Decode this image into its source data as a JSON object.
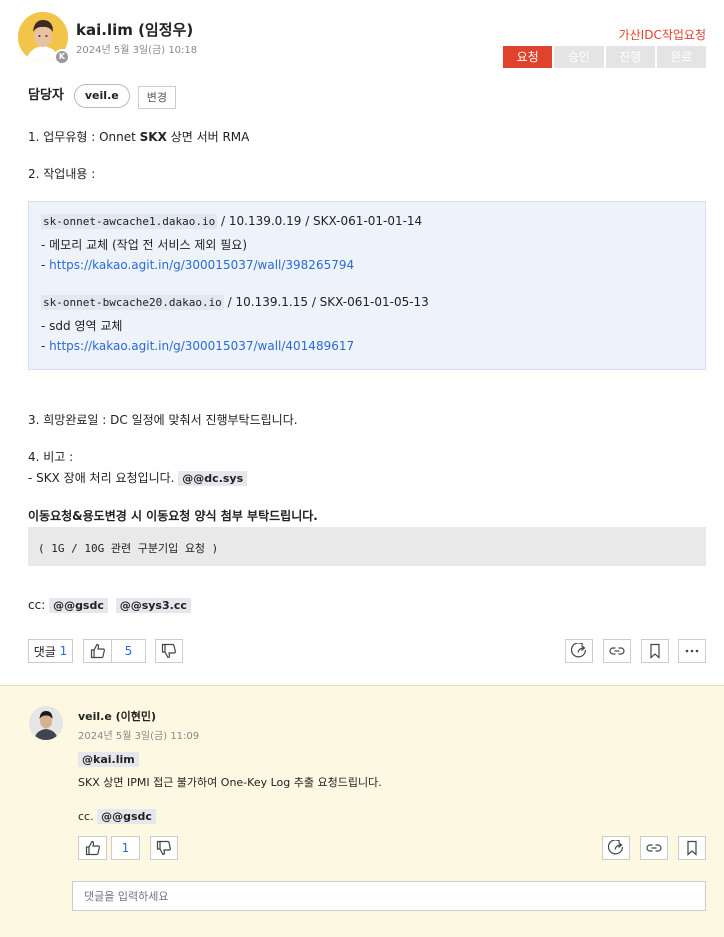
{
  "post": {
    "author_name": "kai.lim (임정우)",
    "avatar_badge": "K",
    "date": "2024년 5월 3일(금) 10:18",
    "group": "가산IDC작업요청",
    "status_steps": [
      "요청",
      "승인",
      "진행",
      "완료"
    ],
    "active_step": "요청",
    "assignee_label": "담당자",
    "assignee": "veil.e",
    "change_label": "변경",
    "line1_prefix": "1. 업무유형 : Onnet ",
    "line1_bold": "SKX",
    "line1_suffix": " 상면 서버 RMA",
    "line2": "2. 작업내용 :",
    "hosts": [
      {
        "code": "sk-onnet-awcache1.dakao.io",
        "info": " / 10.139.0.19 / SKX-061-01-01-14",
        "task": "- 메모리 교체 (작업 전 서비스 제외 필요)",
        "dash": "- ",
        "url": "https://kakao.agit.in/g/300015037/wall/398265794"
      },
      {
        "code": "sk-onnet-bwcache20.dakao.io",
        "info": " / 10.139.1.15 / SKX-061-01-05-13",
        "task": "- sdd 영역 교체",
        "dash": "- ",
        "url": "https://kakao.agit.in/g/300015037/wall/401489617"
      }
    ],
    "line3": "3. 희망완료일 : DC 일정에 맞춰서 진행부탁드립니다.",
    "line4": "4. 비고 :",
    "note": "- SKX 장애 처리 요청입니다. ",
    "note_mention": "@@dc.sys",
    "bold_notice": "이동요청&용도변경 시 이동요청 양식 첨부 부탁드립니다.",
    "grey_box": "( 1G / 10G 관련 구분기입 요청 )",
    "cc_label": "cc: ",
    "cc_mentions": [
      "@@gsdc",
      "@@sys3.cc"
    ],
    "comment_count_label": "댓글",
    "comment_count": "1",
    "like_count": "5"
  },
  "comment": {
    "author_name": "veil.e (이현민)",
    "date": "2024년 5월 3일(금) 11:09",
    "mention": "@kai.lim",
    "text": "SKX 상면 IPMI 접근 불가하여 One-Key Log 추출 요청드립니다.",
    "cc_label": "cc. ",
    "cc_mention": "@@gsdc",
    "like_count": "1"
  },
  "comment_input": {
    "placeholder": "댓글을 입력하세요"
  },
  "icons": [
    "thumbs-up-icon",
    "thumbs-down-icon",
    "share-icon",
    "link-icon",
    "bookmark-icon",
    "more-icon"
  ],
  "colors": {
    "accent": "#e0432b",
    "link": "#2a6bd4",
    "comment_bg": "#fdf8e1",
    "code_bg": "#eef2fa"
  }
}
